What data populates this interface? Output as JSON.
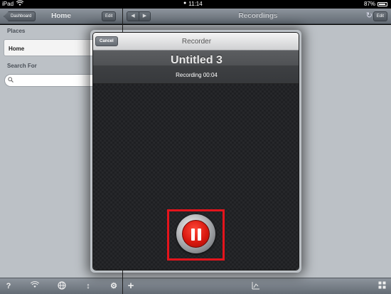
{
  "status_bar": {
    "device": "iPad",
    "time": "11:14",
    "battery": "87%"
  },
  "left_nav": {
    "back_label": "Dashboard",
    "title": "Home",
    "edit_label": "Edit"
  },
  "right_nav": {
    "title": "Recordings",
    "edit_label": "Edit"
  },
  "sidebar": {
    "places_label": "Places",
    "home_item": "Home",
    "search_label": "Search For",
    "search_placeholder": ""
  },
  "recorder": {
    "header_title": "Recorder",
    "cancel_label": "Cancel",
    "recording_name": "Untitled 3",
    "status_text": "Recording 00:04"
  },
  "icons": {
    "left_toolbar": [
      "help-icon",
      "wifi-icon",
      "globe-icon",
      "sort-icon",
      "gear-icon"
    ],
    "right_toolbar": [
      "add-icon",
      "chart-icon",
      "grid-icon"
    ]
  },
  "colors": {
    "record_red": "#d9180f",
    "highlight": "#e4141c"
  }
}
